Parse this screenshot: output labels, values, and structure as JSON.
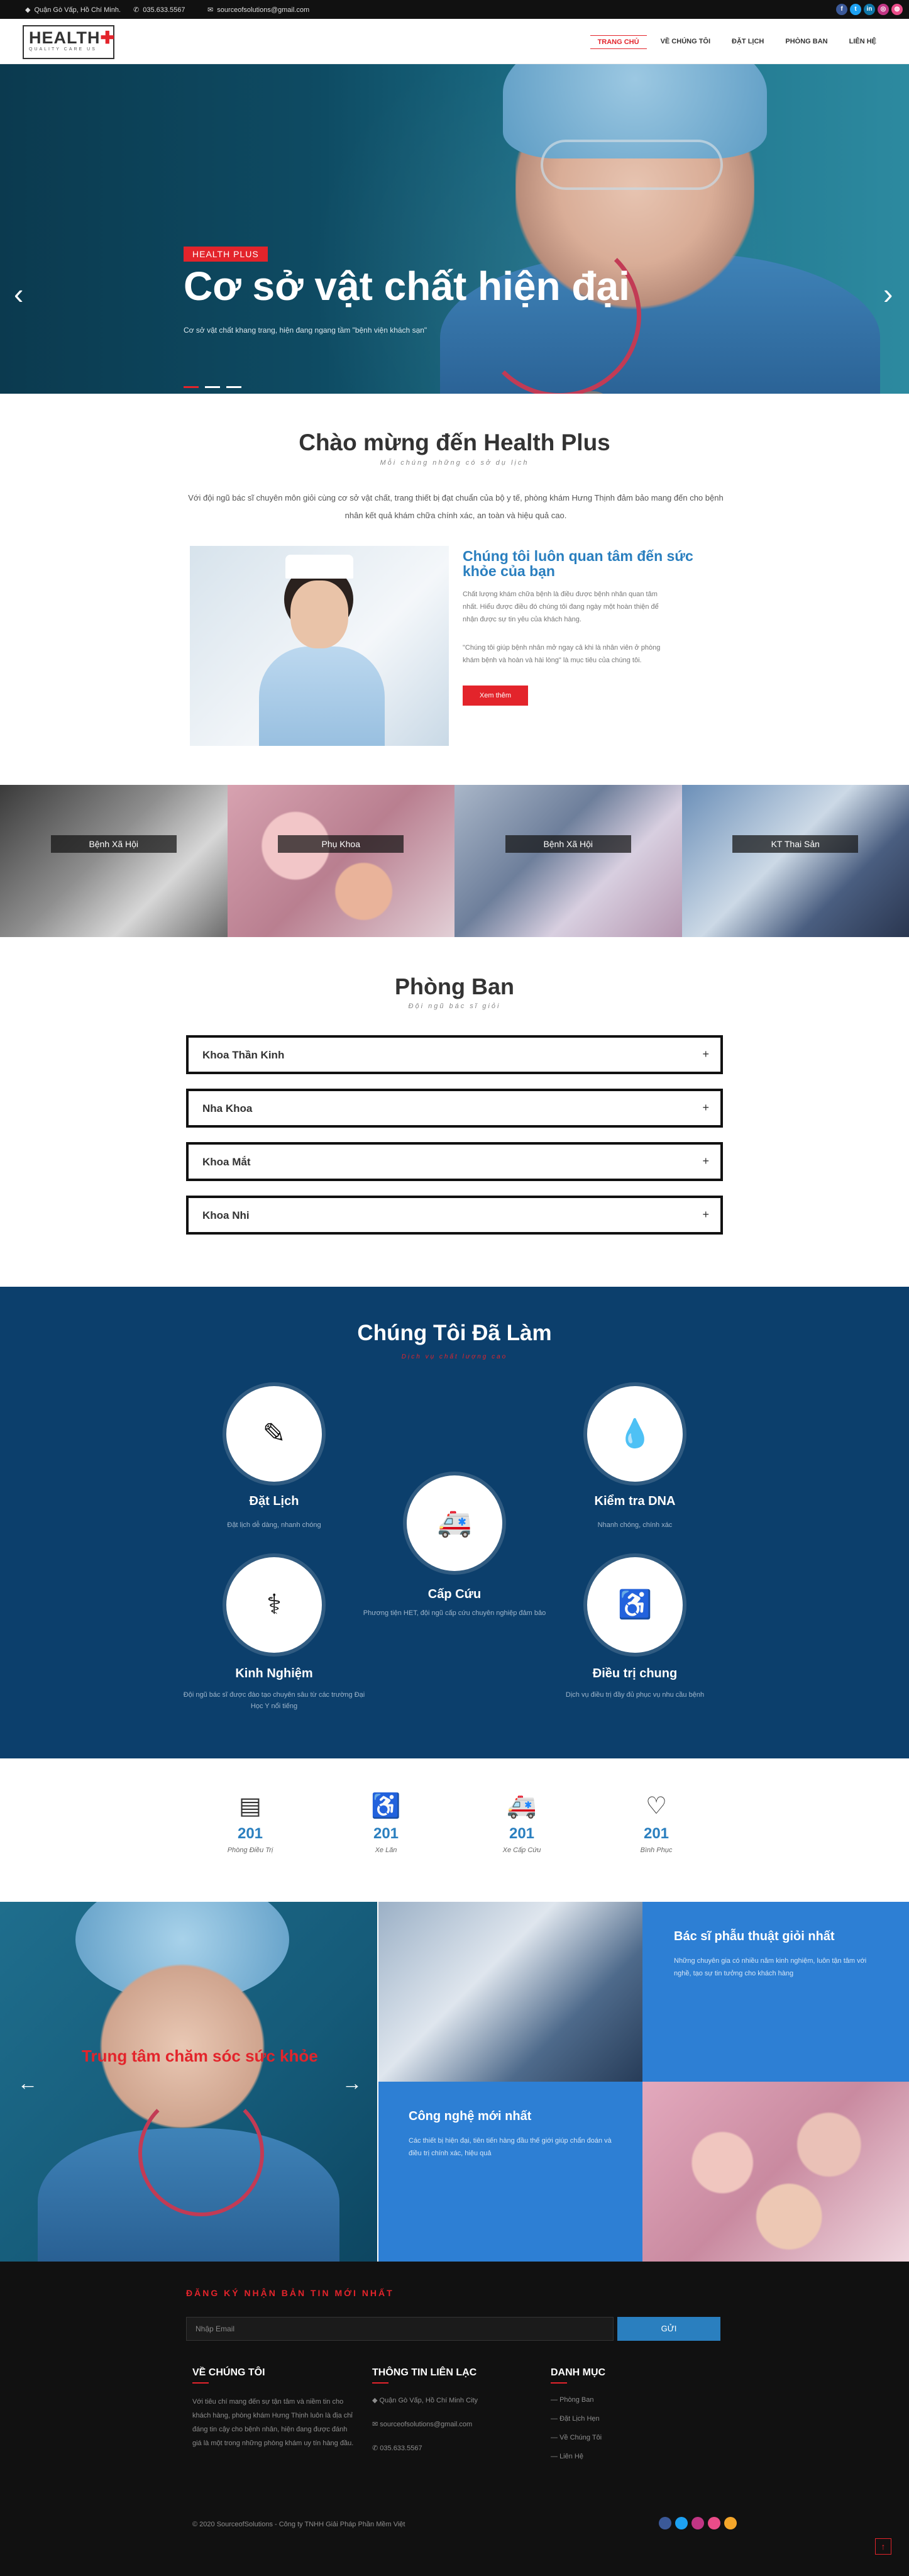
{
  "colors": {
    "brand_red": "#e3242b",
    "brand_blue": "#2a7fbf",
    "navy": "#0c3f6c"
  },
  "topbar": {
    "address": "Quận Gò Vấp, Hồ Chí Minh.",
    "phone": "035.633.5567",
    "email": "sourceofsolutions@gmail.com",
    "icons": [
      "map-marker-icon",
      "phone-icon",
      "envelope-icon"
    ],
    "social": [
      "facebook",
      "twitter",
      "linkedin",
      "instagram",
      "dribbble"
    ]
  },
  "logo": {
    "text": "HEALTH",
    "sub": "QUALITY CARE US"
  },
  "nav": {
    "items": [
      "TRANG CHỦ",
      "VỀ CHÚNG TÔI",
      "ĐẶT LỊCH",
      "PHÒNG BAN",
      "LIÊN HỆ"
    ],
    "active": 0
  },
  "hero": {
    "badge": "HEALTH PLUS",
    "title": "Cơ sở vật chất hiện đại",
    "text": "Cơ sở vật chất khang trang, hiện đang ngang tầm \"bệnh viện khách sạn\"",
    "prev": "‹",
    "next": "›"
  },
  "welcome": {
    "title": "Chào mừng đến Health Plus",
    "subtitle": "Mỗi chúng những có sở dụ lịch",
    "text": "Với đội ngũ bác sĩ chuyên môn giỏi cùng cơ sở vật chất, trang thiết bị đạt chuẩn của bộ y tế, phòng khám Hưng Thịnh đảm bảo mang đến cho bệnh nhân kết quả khám chữa chính xác, an toàn và hiệu quả cao.",
    "care_title": "Chúng tôi luôn quan tâm đến sức khỏe của bạn",
    "care_p1": "Chất lượng khám chữa bệnh là điều được bệnh nhân quan tâm nhất. Hiểu được điều đó chúng tôi đang ngày một hoàn thiện để nhận được sự tin yêu của khách hàng.",
    "care_p2": "\"Chúng tôi giúp bệnh nhân mở ngay cả khi là nhân viên ở phòng khám bệnh và hoàn và hài lòng\" là mục tiêu của chúng tôi.",
    "button": "Xem thêm"
  },
  "gallery": {
    "labels": [
      "Bệnh Xã Hội",
      "Phụ Khoa",
      "Bệnh Xã Hội",
      "KT Thai Sản"
    ]
  },
  "departments": {
    "title": "Phòng Ban",
    "subtitle": "Đội ngũ bác sĩ giỏi",
    "items": [
      "Khoa Thần Kinh",
      "Nha Khoa",
      "Khoa Mắt",
      "Khoa Nhi"
    ],
    "toggle": "+"
  },
  "services": {
    "title": "Chúng Tôi Đã Làm",
    "subtitle": "Dịch vụ chất lượng cao",
    "items": [
      {
        "name": "Đặt Lịch",
        "desc": "Đặt lịch dễ dàng, nhanh chóng",
        "icon": "edit-icon"
      },
      {
        "name": "Kiểm tra DNA",
        "desc": "Nhanh chóng, chính xác",
        "icon": "drop-icon"
      },
      {
        "name": "Cấp Cứu",
        "desc": "Phương tiện HET, đội ngũ cấp cứu chuyên nghiệp đảm bảo",
        "icon": "ambulance-icon"
      },
      {
        "name": "Kinh Nghiệm",
        "desc": "Đội ngũ bác sĩ được đào tạo chuyên sâu từ các trường Đại Học Y nổi tiếng",
        "icon": "doctor-icon"
      },
      {
        "name": "Điều trị chung",
        "desc": "Dịch vụ điều trị đầy đủ phục vụ nhu cầu bệnh",
        "icon": "wheelchair-icon"
      }
    ]
  },
  "stats": [
    {
      "value": "201",
      "label": "Phòng Điều Trị",
      "icon": "building-icon",
      "glyph": "▤"
    },
    {
      "value": "201",
      "label": "Xe Lăn",
      "icon": "wheelchair-icon",
      "glyph": "♿"
    },
    {
      "value": "201",
      "label": "Xe Cấp Cứu",
      "icon": "ambulance-icon",
      "glyph": "🚑"
    },
    {
      "value": "201",
      "label": "Bình Phục",
      "icon": "heart-icon",
      "glyph": "♡"
    }
  ],
  "promo": {
    "left_title": "Trung tâm chăm sóc",
    "left_title_red": "sức khỏe",
    "cell1_title": "Bác sĩ phẫu thuật giỏi nhất",
    "cell1_text": "Những chuyên gia có nhiều năm kinh nghiệm, luôn tận tâm với nghề, tạo sự tin tưởng cho khách hàng",
    "cell2_title": "Công nghệ mới nhất",
    "cell2_text": "Các thiết bị hiện đại, tiên tiến hàng đầu thế giới giúp chẩn đoán và điều trị chính xác, hiệu quả",
    "prev": "←",
    "next": "→"
  },
  "footer": {
    "nl_label": "ĐĂNG KÝ NHẬN BẢN TIN MỚI NHẤT",
    "nl_placeholder": "Nhập Email",
    "nl_button": "GỬI",
    "col1_title": "VỀ CHÚNG TÔI",
    "col1_text": "Với tiêu chí mang đến sự tận tâm và niềm tin cho khách hàng, phòng khám Hưng Thịnh luôn là địa chỉ đáng tin cậy cho bệnh nhân, hiện đang được đánh giá là một trong những phòng khám uy tín hàng đầu.",
    "col2_title": "THÔNG TIN LIÊN LẠC",
    "col2_address": "Quận Gò Vấp, Hồ Chí Minh City",
    "col2_email": "sourceofsolutions@gmail.com",
    "col2_phone": "035.633.5567",
    "col3_title": "DANH MỤC",
    "col3_links": [
      "Phòng Ban",
      "Đặt Lịch Hẹn",
      "Về Chúng Tôi",
      "Liên Hệ"
    ],
    "copyright": "© 2020 SourceofSolutions - Công ty TNHH Giải Pháp Phần Mềm Việt"
  }
}
